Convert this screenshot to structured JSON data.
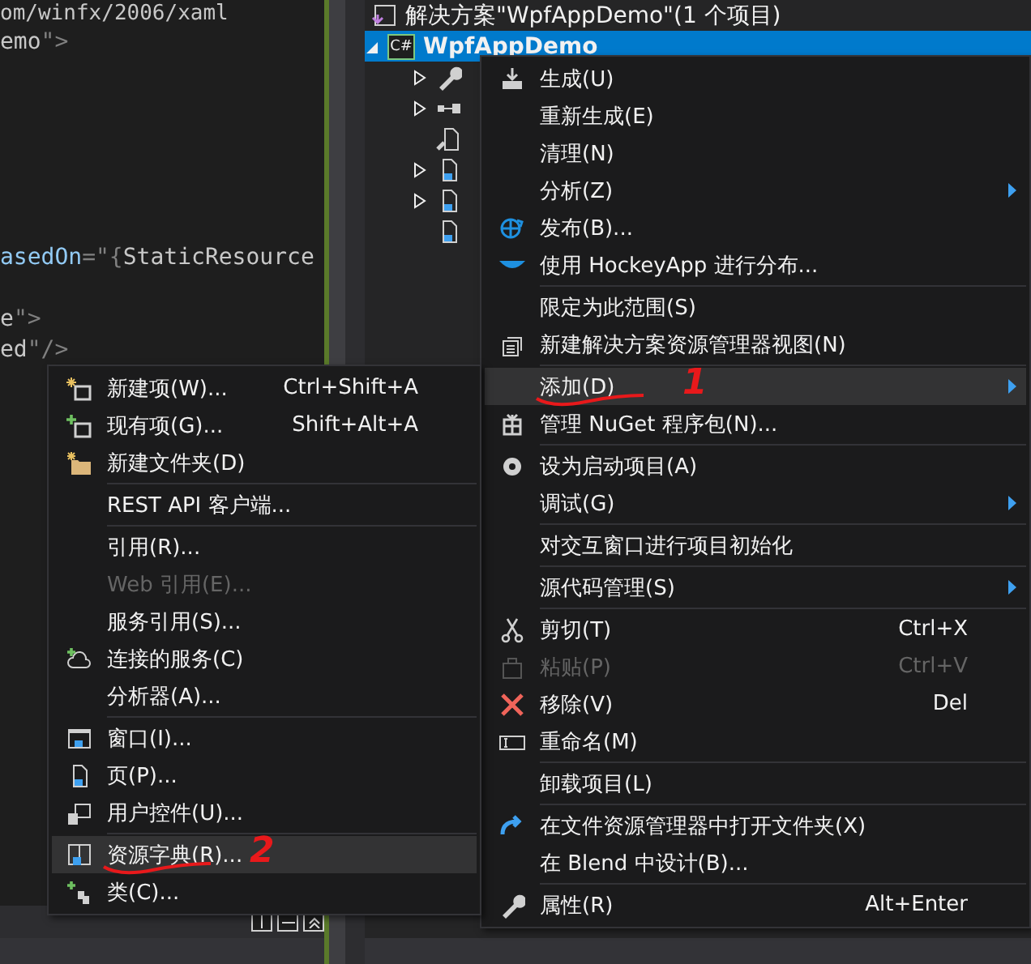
{
  "editor": {
    "lines": [
      {
        "kind": "code",
        "parts": [
          {
            "text": "om/winfx/2006/xaml",
            "kind": "value"
          }
        ]
      },
      {
        "kind": "code",
        "parts": [
          {
            "text": "emo",
            "kind": "value"
          },
          {
            "text": "\">",
            "kind": "punct"
          }
        ]
      },
      {
        "kind": "blank"
      },
      {
        "kind": "blank"
      },
      {
        "kind": "blank"
      },
      {
        "kind": "blank"
      },
      {
        "kind": "blank"
      },
      {
        "kind": "blank"
      },
      {
        "kind": "code",
        "parts": [
          {
            "text": "asedOn",
            "kind": "attr"
          },
          {
            "text": "=\"{",
            "kind": "punct"
          },
          {
            "text": "StaticResource",
            "kind": "value"
          }
        ]
      },
      {
        "kind": "blank"
      },
      {
        "kind": "code",
        "parts": [
          {
            "text": "e",
            "kind": "value"
          },
          {
            "text": "\">",
            "kind": "punct"
          }
        ]
      },
      {
        "kind": "code",
        "parts": [
          {
            "text": "ed",
            "kind": "value"
          },
          {
            "text": "\"/>",
            "kind": "punct"
          }
        ]
      }
    ]
  },
  "solution_explorer": {
    "solution": "解决方案\"WpfAppDemo\"(1 个项目)",
    "project": {
      "badge": "C#",
      "label": "WpfAppDemo",
      "selected": true,
      "expanded": true,
      "children": [
        {
          "kind": "wrench",
          "expandable": true
        },
        {
          "kind": "references",
          "expandable": true
        },
        {
          "kind": "config",
          "expandable": false
        },
        {
          "kind": "xaml",
          "expandable": true
        },
        {
          "kind": "xaml",
          "expandable": true
        },
        {
          "kind": "xaml",
          "expandable": false
        }
      ]
    }
  },
  "context_menu": {
    "items": [
      {
        "kind": "build",
        "label": "生成(U)",
        "highlighted": false,
        "disabled": false
      },
      {
        "kind": "text",
        "label": "重新生成(E)",
        "highlighted": false,
        "disabled": false
      },
      {
        "kind": "text",
        "label": "清理(N)",
        "highlighted": false,
        "disabled": false
      },
      {
        "kind": "text",
        "label": "分析(Z)",
        "submenu": true,
        "highlighted": false,
        "disabled": false
      },
      {
        "kind": "globe",
        "label": "发布(B)...",
        "highlighted": false,
        "disabled": false
      },
      {
        "kind": "dish",
        "label": "使用 HockeyApp 进行分布...",
        "highlighted": false,
        "disabled": false
      },
      {
        "kind": "separator"
      },
      {
        "kind": "text",
        "label": "限定为此范围(S)",
        "highlighted": false,
        "disabled": false
      },
      {
        "kind": "views",
        "label": "新建解决方案资源管理器视图(N)",
        "highlighted": false,
        "disabled": false
      },
      {
        "kind": "separator"
      },
      {
        "kind": "text",
        "label": "添加(D)",
        "submenu": true,
        "highlighted": true,
        "disabled": false,
        "annotation": "1"
      },
      {
        "kind": "package",
        "label": "管理 NuGet 程序包(N)...",
        "highlighted": false,
        "disabled": false
      },
      {
        "kind": "separator"
      },
      {
        "kind": "gear",
        "label": "设为启动项目(A)",
        "highlighted": false,
        "disabled": false
      },
      {
        "kind": "text",
        "label": "调试(G)",
        "submenu": true,
        "highlighted": false,
        "disabled": false
      },
      {
        "kind": "separator"
      },
      {
        "kind": "text",
        "label": "对交互窗口进行项目初始化",
        "highlighted": false,
        "disabled": false
      },
      {
        "kind": "separator"
      },
      {
        "kind": "text",
        "label": "源代码管理(S)",
        "submenu": true,
        "highlighted": false,
        "disabled": false
      },
      {
        "kind": "separator"
      },
      {
        "kind": "scissors",
        "label": "剪切(T)",
        "shortcut": "Ctrl+X",
        "highlighted": false,
        "disabled": false
      },
      {
        "kind": "clipboard",
        "label": "粘贴(P)",
        "shortcut": "Ctrl+V",
        "highlighted": false,
        "disabled": true
      },
      {
        "kind": "cross",
        "label": "移除(V)",
        "shortcut": "Del",
        "highlighted": false,
        "disabled": false
      },
      {
        "kind": "rename",
        "label": "重命名(M)",
        "highlighted": false,
        "disabled": false
      },
      {
        "kind": "separator"
      },
      {
        "kind": "text",
        "label": "卸载项目(L)",
        "highlighted": false,
        "disabled": false
      },
      {
        "kind": "separator"
      },
      {
        "kind": "curved-arrow",
        "label": "在文件资源管理器中打开文件夹(X)",
        "highlighted": false,
        "disabled": false
      },
      {
        "kind": "text",
        "label": "在 Blend 中设计(B)...",
        "highlighted": false,
        "disabled": false
      },
      {
        "kind": "separator"
      },
      {
        "kind": "wrench",
        "label": "属性(R)",
        "shortcut": "Alt+Enter",
        "highlighted": false,
        "disabled": false
      }
    ]
  },
  "add_submenu": {
    "items": [
      {
        "kind": "new-item",
        "label": "新建项(W)...",
        "shortcut": "Ctrl+Shift+A",
        "highlighted": false,
        "disabled": false
      },
      {
        "kind": "existing-item",
        "label": "现有项(G)...",
        "shortcut": "Shift+Alt+A",
        "highlighted": false,
        "disabled": false
      },
      {
        "kind": "folder",
        "label": "新建文件夹(D)",
        "highlighted": false,
        "disabled": false
      },
      {
        "kind": "separator"
      },
      {
        "kind": "text",
        "label": "REST API 客户端...",
        "highlighted": false,
        "disabled": false
      },
      {
        "kind": "separator"
      },
      {
        "kind": "text",
        "label": "引用(R)...",
        "highlighted": false,
        "disabled": false
      },
      {
        "kind": "text",
        "label": "Web 引用(E)...",
        "highlighted": false,
        "disabled": true
      },
      {
        "kind": "text",
        "label": "服务引用(S)...",
        "highlighted": false,
        "disabled": false
      },
      {
        "kind": "cloud",
        "label": "连接的服务(C)",
        "highlighted": false,
        "disabled": false
      },
      {
        "kind": "text",
        "label": "分析器(A)...",
        "highlighted": false,
        "disabled": false
      },
      {
        "kind": "separator"
      },
      {
        "kind": "window",
        "label": "窗口(I)...",
        "highlighted": false,
        "disabled": false
      },
      {
        "kind": "xaml",
        "label": "页(P)...",
        "highlighted": false,
        "disabled": false
      },
      {
        "kind": "user-control",
        "label": "用户控件(U)...",
        "highlighted": false,
        "disabled": false
      },
      {
        "kind": "separator"
      },
      {
        "kind": "dictionary",
        "label": "资源字典(R)...",
        "highlighted": true,
        "disabled": false,
        "annotation": "2"
      },
      {
        "kind": "class",
        "label": "类(C)...",
        "highlighted": false,
        "disabled": false
      }
    ]
  }
}
